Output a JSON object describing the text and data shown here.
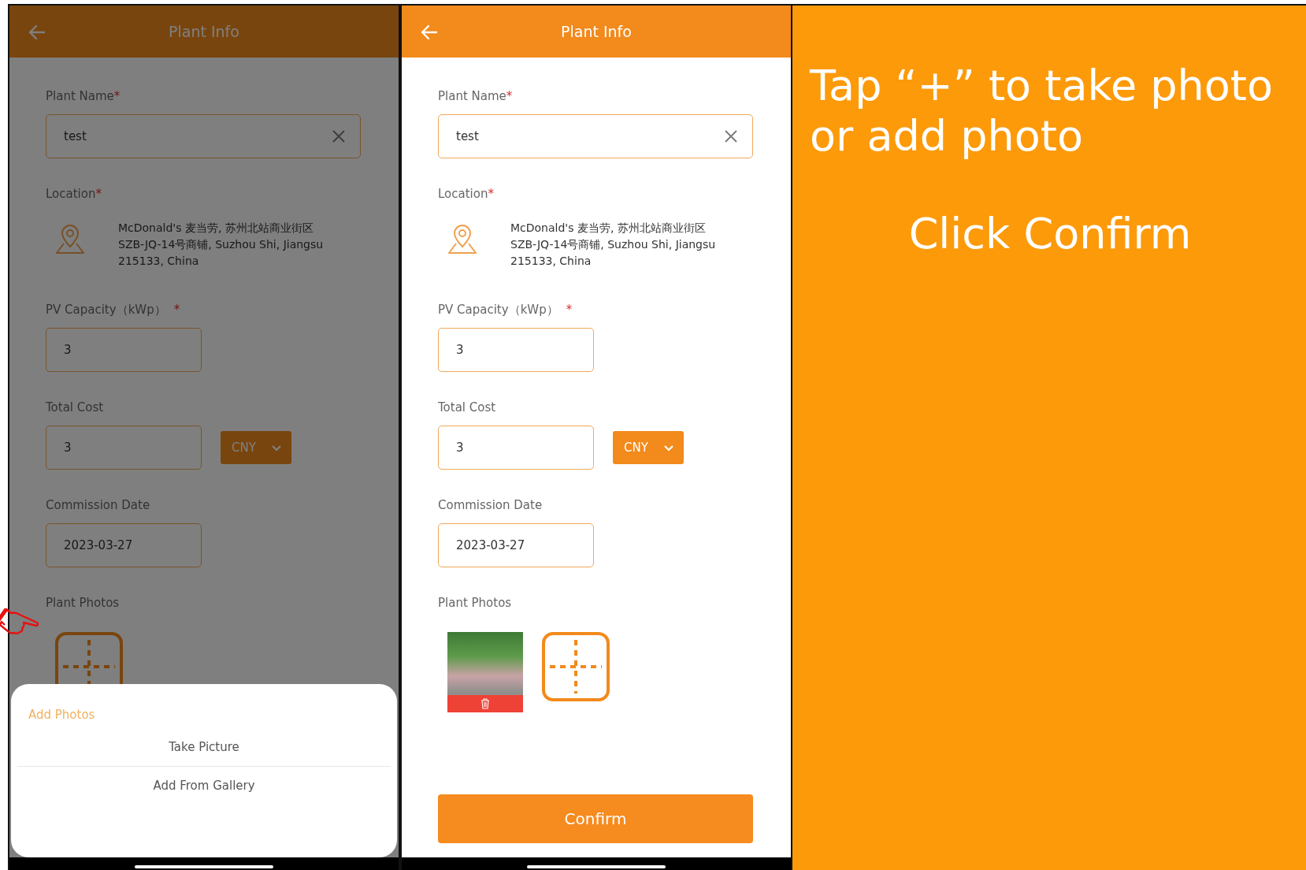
{
  "screens": [
    {
      "dimmed": true,
      "pointer": true,
      "title": "Plant Info",
      "plant_name": {
        "label": "Plant Name",
        "asterisk": "*",
        "value": "test"
      },
      "location": {
        "label": "Location",
        "asterisk": "*",
        "address_lines": [
          "McDonald's 麦当劳, 苏州北站商业街区",
          "SZB-JQ-14号商铺, Suzhou Shi, Jiangsu",
          "215133, China"
        ]
      },
      "pv_capacity": {
        "label": "PV Capacity（kWp）",
        "asterisk": "*",
        "value": "3"
      },
      "total_cost": {
        "label": "Total Cost",
        "value": "3",
        "currency": "CNY"
      },
      "commission_date": {
        "label": "Commission Date",
        "value": "2023-03-27"
      },
      "photos": {
        "label": "Plant Photos"
      },
      "sheet": {
        "title": "Add Photos",
        "options": [
          "Take Picture",
          "Add From Gallery"
        ]
      }
    },
    {
      "dimmed": false,
      "title": "Plant Info",
      "plant_name": {
        "label": "Plant Name",
        "asterisk": "*",
        "value": "test"
      },
      "location": {
        "label": "Location",
        "asterisk": "*",
        "address_lines": [
          "McDonald's 麦当劳, 苏州北站商业街区",
          "SZB-JQ-14号商铺, Suzhou Shi, Jiangsu",
          "215133, China"
        ]
      },
      "pv_capacity": {
        "label": "PV Capacity（kWp）",
        "asterisk": "*",
        "value": "3"
      },
      "total_cost": {
        "label": "Total Cost",
        "value": "3",
        "currency": "CNY"
      },
      "commission_date": {
        "label": "Commission Date",
        "value": "2023-03-27"
      },
      "photos": {
        "label": "Plant Photos",
        "items": [
          {
            "kind": "photo"
          }
        ]
      },
      "confirm": "Confirm"
    }
  ],
  "instructions": [
    "Tap “+” to take photo or add photo",
    "Click Confirm"
  ]
}
